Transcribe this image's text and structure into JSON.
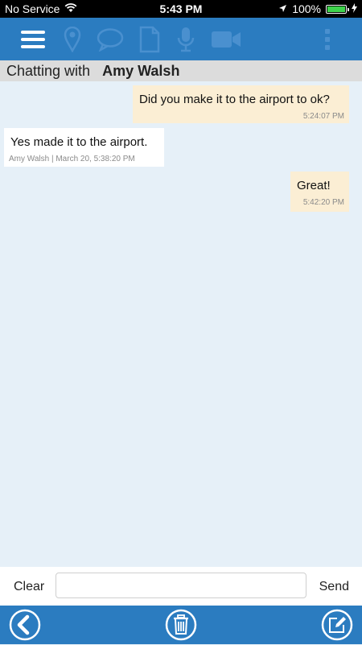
{
  "status_bar": {
    "carrier": "No Service",
    "time": "5:43 PM",
    "battery": "100%"
  },
  "toolbar": {
    "icons": [
      "menu-icon",
      "location-pin-icon",
      "chat-bubble-icon",
      "document-icon",
      "microphone-icon",
      "video-camera-icon",
      "more-vertical-icon"
    ]
  },
  "chat_header": {
    "prefix": "Chatting with",
    "contact_name": "Amy Walsh"
  },
  "messages": [
    {
      "direction": "outgoing",
      "text": "Did you make it to the airport to ok?",
      "meta": "5:24:07 PM"
    },
    {
      "direction": "incoming",
      "text": "Yes made it to the airport.",
      "meta": "Amy Walsh | March 20, 5:38:20 PM"
    },
    {
      "direction": "outgoing",
      "text": "Great!",
      "meta": "5:42:20 PM"
    }
  ],
  "input_bar": {
    "clear_label": "Clear",
    "send_label": "Send",
    "message_value": "",
    "placeholder": ""
  },
  "colors": {
    "toolbar": "#2b7cc0",
    "toolbar_icon_dim": "#4a90cf",
    "outgoing_bubble": "#fbeed4",
    "incoming_bubble": "#ffffff",
    "chat_background": "#e6f0f8"
  }
}
